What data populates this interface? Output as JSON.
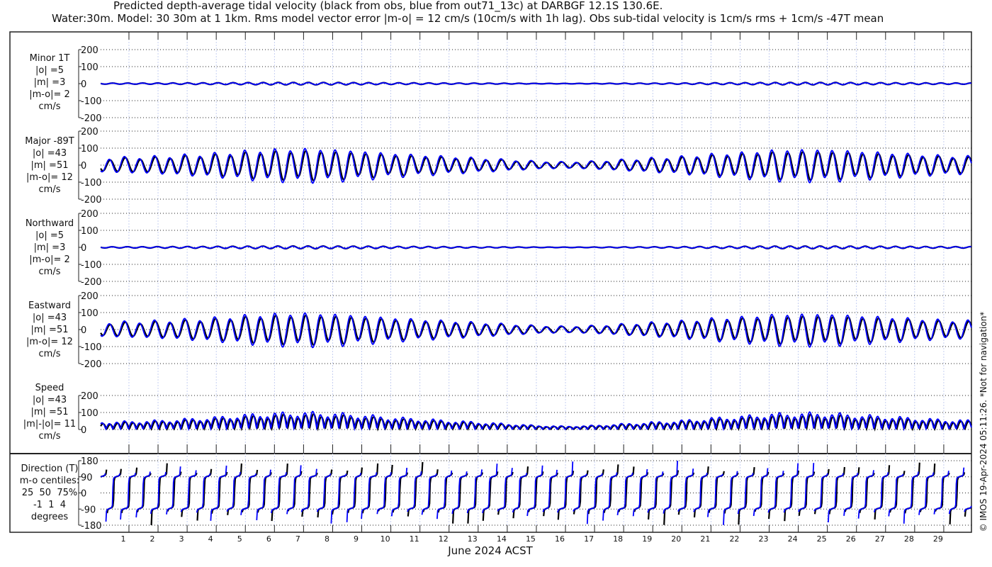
{
  "chart_data": {
    "type": "line",
    "title": "Predicted depth-average tidal velocity (black from obs, blue from out71_13c) at DARBGF 12.1S 130.6E.",
    "subtitle": "Water:30m. Model: 30 30m at 1 1km. Rms model vector error |m-o| = 12 cm/s (10cm/s with 1h lag). Obs sub-tidal velocity is 1cm/s rms + 1cm/s -47T mean",
    "xlabel": "June 2024 ACST",
    "x_ticks": [
      "1",
      "2",
      "3",
      "4",
      "5",
      "6",
      "7",
      "8",
      "9",
      "10",
      "11",
      "12",
      "13",
      "14",
      "15",
      "16",
      "17",
      "18",
      "19",
      "20",
      "21",
      "22",
      "23",
      "24",
      "25",
      "26",
      "27",
      "28",
      "29"
    ],
    "xlim_days": [
      0,
      30
    ],
    "series": [
      {
        "name": "obs",
        "color": "#000000"
      },
      {
        "name": "model out71_13c",
        "color": "#0000ff"
      }
    ],
    "tidal_period_hours": 12.42,
    "major_daily_amplitude_cm_s": [
      45,
      50,
      55,
      65,
      75,
      90,
      100,
      105,
      100,
      90,
      75,
      65,
      55,
      45,
      35,
      25,
      20,
      25,
      35,
      45,
      55,
      70,
      80,
      95,
      100,
      100,
      90,
      80,
      70,
      60,
      55
    ],
    "panels": [
      {
        "key": "minor",
        "lines": [
          "Minor 1T",
          "|o| =5",
          "|m| =3",
          "|m-o|= 2",
          "cm/s"
        ],
        "ylim": [
          -200,
          200
        ],
        "yticks": [
          "200",
          "100",
          "0",
          "-100",
          "-200"
        ]
      },
      {
        "key": "major",
        "lines": [
          "Major -89T",
          "|o| =43",
          "|m| =51",
          "|m-o|= 12",
          "cm/s"
        ],
        "ylim": [
          -200,
          200
        ],
        "yticks": [
          "200",
          "100",
          "0",
          "-100",
          "-200"
        ]
      },
      {
        "key": "north",
        "lines": [
          "Northward",
          "|o| =5",
          "|m| =3",
          "|m-o|= 2",
          "cm/s"
        ],
        "ylim": [
          -200,
          200
        ],
        "yticks": [
          "200",
          "100",
          "0",
          "-100",
          "-200"
        ]
      },
      {
        "key": "east",
        "lines": [
          "Eastward",
          "|o| =43",
          "|m| =51",
          "|m-o|= 12",
          "cm/s"
        ],
        "ylim": [
          -200,
          200
        ],
        "yticks": [
          "200",
          "100",
          "0",
          "-100",
          "-200"
        ]
      },
      {
        "key": "speed",
        "lines": [
          "Speed",
          "|o| =43",
          "|m| =51",
          "|m|-|o|= 11",
          "cm/s"
        ],
        "ylim": [
          0,
          200
        ],
        "yticks": [
          "200",
          "100",
          "0"
        ]
      },
      {
        "key": "direction",
        "lines": [
          "Direction (T)",
          "m-o centiles:",
          "25  50  75%",
          "-1  1  4",
          "degrees"
        ],
        "ylim": [
          -180,
          180
        ],
        "yticks": [
          "180",
          "90",
          "0",
          "-90",
          "-180"
        ]
      }
    ],
    "grid": true
  },
  "credit": "© IMOS 19-Apr-2024 05:11:26. *Not for navigation*"
}
